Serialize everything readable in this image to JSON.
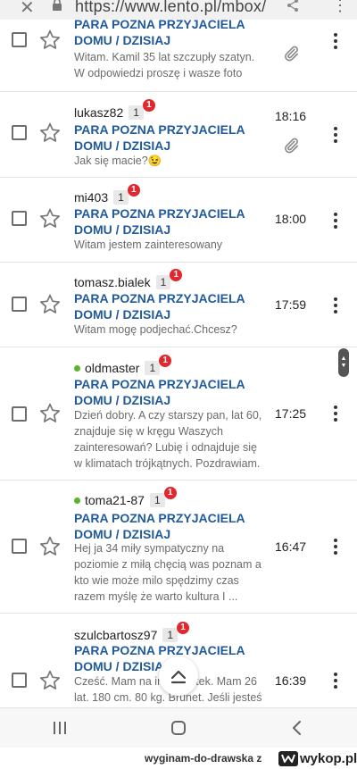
{
  "browser": {
    "url": "https://www.lento.pl/mbox/"
  },
  "messages": [
    {
      "sender": "",
      "count": "",
      "badge": "",
      "online": false,
      "subject": "PARA POZNA PRZYJACIELA DOMU / DZISIAJ",
      "preview": "Witam. Kamil 35 lat szczupły szatyn. W odpowiedzi proszę i wasze foto",
      "time": "",
      "attachment": true
    },
    {
      "sender": "lukasz82",
      "count": "1",
      "badge": "1",
      "online": false,
      "subject": "PARA POZNA PRZYJACIELA DOMU / DZISIAJ",
      "preview": "Jak się macie?😉",
      "time": "18:16",
      "attachment": true
    },
    {
      "sender": "mi403",
      "count": "1",
      "badge": "1",
      "online": false,
      "subject": "PARA POZNA PRZYJACIELA DOMU / DZISIAJ",
      "preview": "Witam jestem zainteresowany",
      "time": "18:00",
      "attachment": false
    },
    {
      "sender": "tomasz.bialek",
      "count": "1",
      "badge": "1",
      "online": false,
      "subject": "PARA POZNA PRZYJACIELA DOMU / DZISIAJ",
      "preview": "Witam mogę podjechać.Chcesz?",
      "time": "17:59",
      "attachment": false
    },
    {
      "sender": "oldmaster",
      "count": "1",
      "badge": "1",
      "online": true,
      "subject": "PARA POZNA PRZYJACIELA DOMU / DZISIAJ",
      "preview": "Dzień dobry. A czy starszy pan, lat 60, znajduje się w kręgu Waszych zainteresowań? Lubię i odnajduje się w klimatach trójkątnych. Pozdrawiam. J.",
      "time": "17:25",
      "attachment": false
    },
    {
      "sender": "toma21-87",
      "count": "1",
      "badge": "1",
      "online": true,
      "subject": "PARA POZNA PRZYJACIELA DOMU / DZISIAJ",
      "preview": "Hej ja 34 miły sympatyczny na poziomie z miłą chęcią was poznam a kto wie może milo spędzimy czas razem myślę że warto kultura I ...",
      "time": "16:47",
      "attachment": false
    },
    {
      "sender": "szulcbartosz97",
      "count": "1",
      "badge": "1",
      "online": false,
      "subject": "PARA POZNA PRZYJACIELA DOMU / DZISIAJ",
      "preview": "Cześć. Mam na imię Bartek. Mam 26 lat. 180 cm. 80 kg. Brunet. Jeśli jesteś",
      "time": "16:39",
      "attachment": false
    }
  ],
  "watermark": {
    "text": "wyginam-do-drawska z",
    "logo": "wykop.pl"
  },
  "colors": {
    "subject": "#215a9b",
    "badge": "#e0282e",
    "online": "#5ab52c"
  }
}
